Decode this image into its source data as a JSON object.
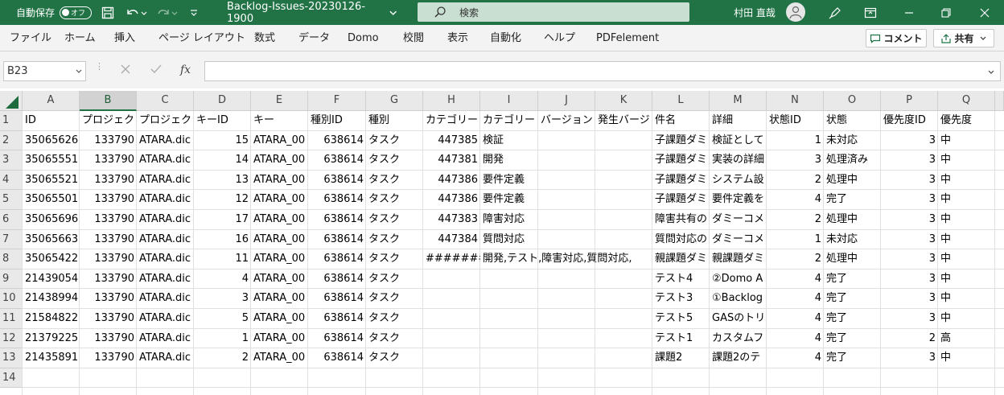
{
  "titlebar": {
    "autosave_label": "自動保存",
    "autosave_state": "オフ",
    "filename": "Backlog-Issues-20230126-1900",
    "search_placeholder": "検索",
    "user_name": "村田 直哉",
    "bg_color": "#217346"
  },
  "ribbon": {
    "tabs": [
      "ファイル",
      "ホーム",
      "挿入",
      "ページ レイアウト",
      "数式",
      "データ",
      "Domo",
      "校閲",
      "表示",
      "自動化",
      "ヘルプ",
      "PDFelement"
    ],
    "comment_label": "コメント",
    "share_label": "共有"
  },
  "formula_bar": {
    "name_box": "B23",
    "fx": "fx",
    "formula": ""
  },
  "grid": {
    "columns": [
      "A",
      "B",
      "C",
      "D",
      "E",
      "F",
      "G",
      "H",
      "I",
      "J",
      "K",
      "L",
      "M",
      "N",
      "O",
      "P",
      "Q"
    ],
    "row_numbers": [
      "1",
      "2",
      "3",
      "4",
      "5",
      "6",
      "7",
      "8",
      "9",
      "10",
      "11",
      "12",
      "13",
      "14"
    ],
    "rows": [
      [
        "ID",
        "プロジェク",
        "プロジェク",
        "キーID",
        "キー",
        "種別ID",
        "種別",
        "カテゴリー",
        "カテゴリー",
        "バージョン",
        "発生バージ",
        "件名",
        "詳細",
        "状態ID",
        "状態",
        "優先度ID",
        "優先度"
      ],
      [
        "35065626",
        "133790",
        "ATARA.dic",
        "15",
        "ATARA_00",
        "638614",
        "タスク",
        "447385",
        "検証",
        "",
        "",
        "子課題ダミ",
        "検証として",
        "1",
        "未対応",
        "3",
        "中"
      ],
      [
        "35065551",
        "133790",
        "ATARA.dic",
        "14",
        "ATARA_00",
        "638614",
        "タスク",
        "447381",
        "開発",
        "",
        "",
        "子課題ダミ",
        "実装の詳細",
        "3",
        "処理済み",
        "3",
        "中"
      ],
      [
        "35065521",
        "133790",
        "ATARA.dic",
        "13",
        "ATARA_00",
        "638614",
        "タスク",
        "447386",
        "要件定義",
        "",
        "",
        "子課題ダミ",
        "システム設",
        "2",
        "処理中",
        "3",
        "中"
      ],
      [
        "35065501",
        "133790",
        "ATARA.dic",
        "12",
        "ATARA_00",
        "638614",
        "タスク",
        "447386",
        "要件定義",
        "",
        "",
        "子課題ダミ",
        "要件定義を",
        "4",
        "完了",
        "3",
        "中"
      ],
      [
        "35065696",
        "133790",
        "ATARA.dic",
        "17",
        "ATARA_00",
        "638614",
        "タスク",
        "447383",
        "障害対応",
        "",
        "",
        "障害共有の",
        "ダミーコメ",
        "2",
        "処理中",
        "3",
        "中"
      ],
      [
        "35065663",
        "133790",
        "ATARA.dic",
        "16",
        "ATARA_00",
        "638614",
        "タスク",
        "447384",
        "質問対応",
        "",
        "",
        "質問対応の",
        "ダミーコメ",
        "1",
        "未対応",
        "3",
        "中"
      ],
      [
        "35065422",
        "133790",
        "ATARA.dic",
        "11",
        "ATARA_00",
        "638614",
        "タスク",
        "#######",
        "開発,テスト,障害対応,質問対応,",
        "",
        "",
        "親課題ダミ",
        "親課題ダミ",
        "2",
        "処理中",
        "3",
        "中"
      ],
      [
        "21439054",
        "133790",
        "ATARA.dic",
        "4",
        "ATARA_00",
        "638614",
        "タスク",
        "",
        "",
        "",
        "",
        "テスト4",
        "②Domo A",
        "4",
        "完了",
        "3",
        "中"
      ],
      [
        "21438994",
        "133790",
        "ATARA.dic",
        "3",
        "ATARA_00",
        "638614",
        "タスク",
        "",
        "",
        "",
        "",
        "テスト3",
        "①Backlog",
        "4",
        "完了",
        "3",
        "中"
      ],
      [
        "21584822",
        "133790",
        "ATARA.dic",
        "5",
        "ATARA_00",
        "638614",
        "タスク",
        "",
        "",
        "",
        "",
        "テスト5",
        "GASのトリ",
        "4",
        "完了",
        "3",
        "中"
      ],
      [
        "21379225",
        "133790",
        "ATARA.dic",
        "1",
        "ATARA_00",
        "638614",
        "タスク",
        "",
        "",
        "",
        "",
        "テスト1",
        "カスタムフ",
        "4",
        "完了",
        "2",
        "高"
      ],
      [
        "21435891",
        "133790",
        "ATARA.dic",
        "2",
        "ATARA_00",
        "638614",
        "タスク",
        "",
        "",
        "",
        "",
        "課題2",
        "課題2のテ",
        "4",
        "完了",
        "3",
        "中"
      ],
      [
        "",
        "",
        "",
        "",
        "",
        "",
        "",
        "",
        "",
        "",
        "",
        "",
        "",
        "",
        "",
        "",
        ""
      ]
    ],
    "numeric_columns": [
      0,
      1,
      3,
      5,
      7,
      13,
      15
    ]
  }
}
